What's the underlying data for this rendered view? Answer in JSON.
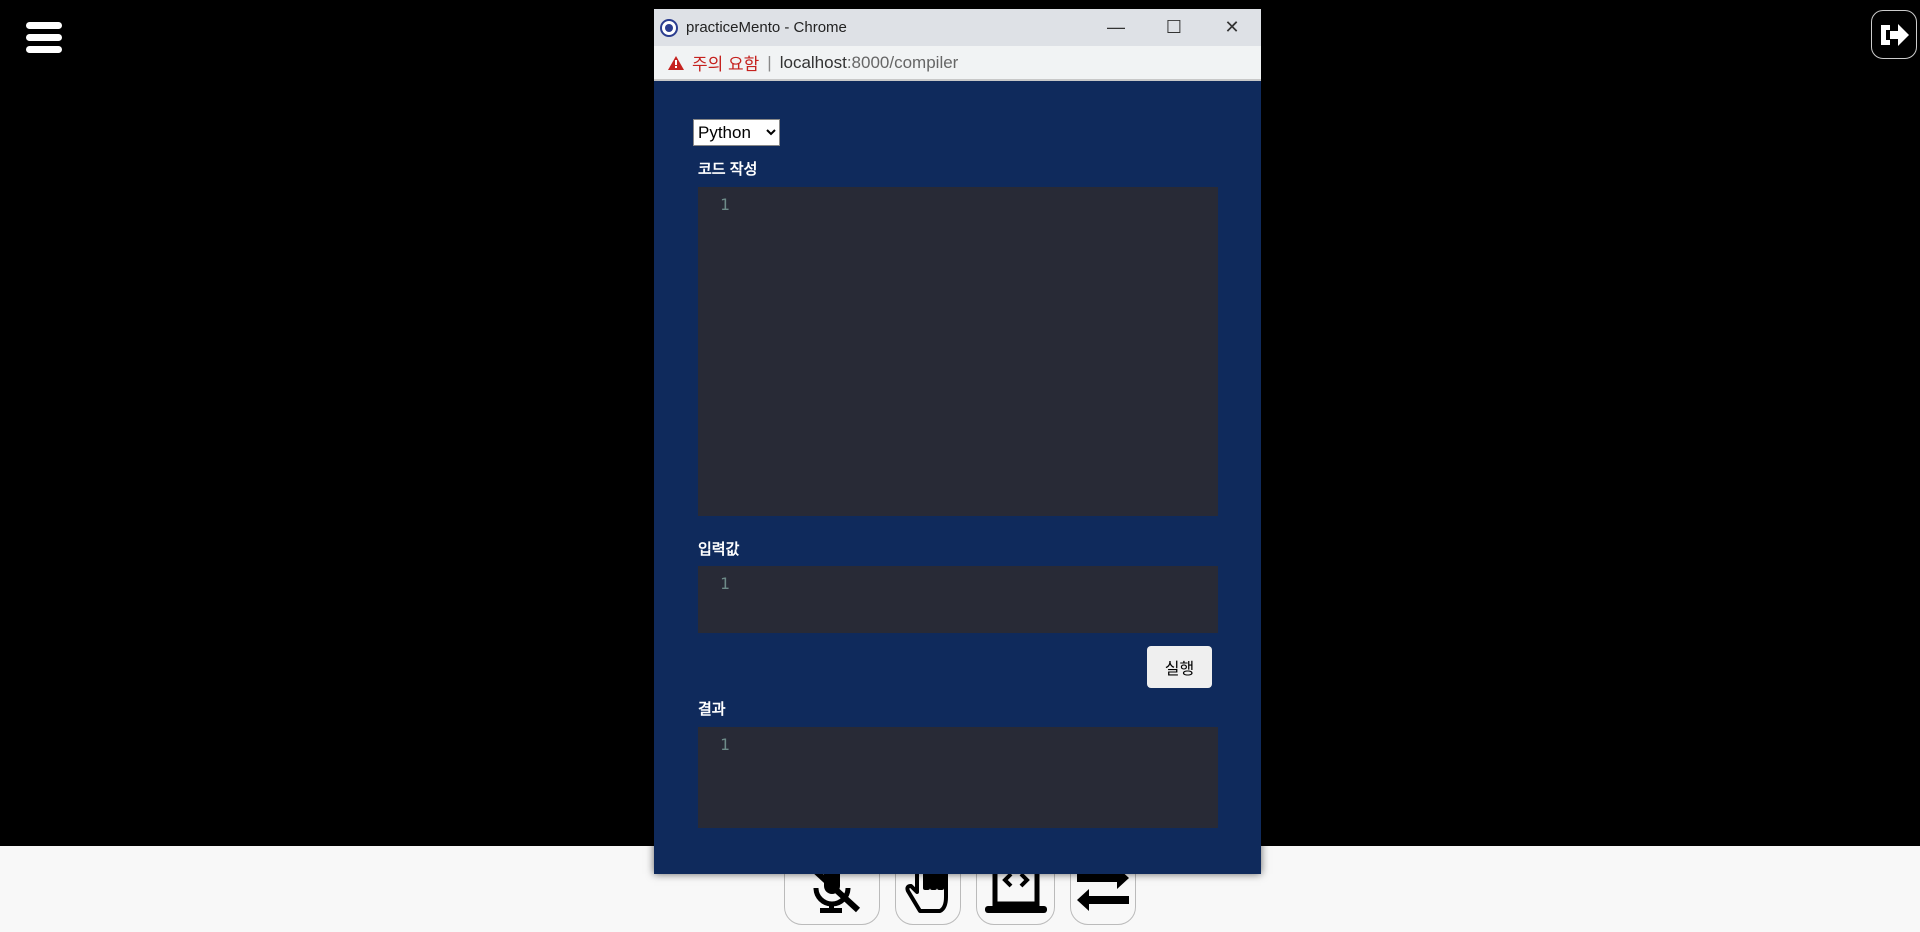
{
  "window": {
    "title": "practiceMento - Chrome",
    "minimize": "—",
    "maximize": "☐",
    "close": "✕"
  },
  "address": {
    "warning": "주의 요함",
    "separator": "|",
    "host": "localhost",
    "path": ":8000/compiler"
  },
  "language_select": {
    "value": "Python",
    "options": [
      "Python"
    ]
  },
  "code_label": "코드 작성",
  "input_label": "입력값",
  "result_label": "결과",
  "line_number": "1",
  "run_button": "실행",
  "icons": [
    "menu-icon",
    "exit-icon",
    "mic-off-icon",
    "hand-icon",
    "code-laptop-icon",
    "swap-icon"
  ]
}
